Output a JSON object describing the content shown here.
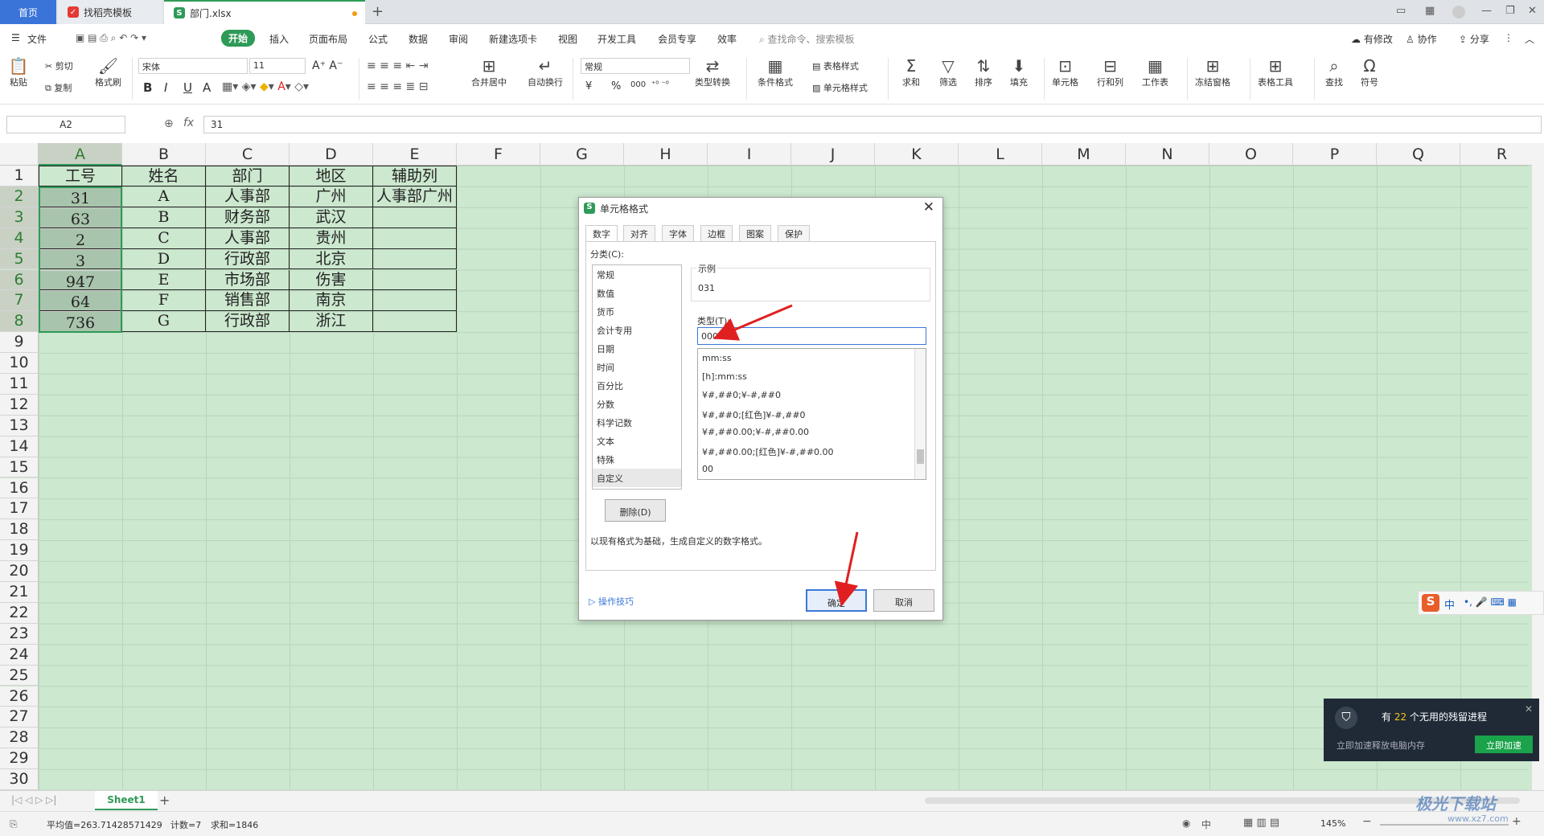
{
  "tabs": {
    "home": "首页",
    "template": "找稻壳模板",
    "file": "部门.xlsx",
    "new_tab": "+"
  },
  "menu": {
    "file": "文件",
    "items": [
      "开始",
      "插入",
      "页面布局",
      "公式",
      "数据",
      "审阅",
      "新建选项卡",
      "视图",
      "开发工具",
      "会员专享",
      "效率"
    ],
    "search_placeholder": "查找命令、搜索模板",
    "has_changes": "有修改",
    "collab": "协作",
    "share": "分享"
  },
  "ribbon": {
    "paste": "粘贴",
    "cut": "剪切",
    "copy": "复制",
    "format_painter": "格式刷",
    "font_name": "宋体",
    "font_size": "11",
    "bold": "B",
    "italic": "I",
    "underline": "U",
    "strike": "A",
    "merge_center": "合并居中",
    "auto_wrap": "自动换行",
    "number_format": "常规",
    "currency": "¥",
    "percent": "%",
    "thousands": "000",
    "type_convert": "类型转换",
    "cond_format": "条件格式",
    "table_style": "表格样式",
    "cell_style": "单元格样式",
    "sum": "求和",
    "filter": "筛选",
    "sort": "排序",
    "fill": "填充",
    "cell": "单元格",
    "row_col": "行和列",
    "worksheet": "工作表",
    "freeze": "冻结窗格",
    "table_tools": "表格工具",
    "find": "查找",
    "symbol": "符号"
  },
  "formula_bar": {
    "name_box": "A2",
    "fx": "fx",
    "value": "31"
  },
  "columns": [
    "A",
    "B",
    "C",
    "D",
    "E",
    "F",
    "G",
    "H",
    "I",
    "J",
    "K",
    "L",
    "M",
    "N",
    "O",
    "P",
    "Q",
    "R"
  ],
  "rows": [
    "1",
    "2",
    "3",
    "4",
    "5",
    "6",
    "7",
    "8",
    "9",
    "10",
    "11",
    "12",
    "13",
    "14",
    "15",
    "16",
    "17",
    "18",
    "19",
    "20",
    "21",
    "22",
    "23",
    "24",
    "25",
    "26",
    "27",
    "28",
    "29",
    "30"
  ],
  "table": {
    "headers": [
      "工号",
      "姓名",
      "部门",
      "地区",
      "辅助列"
    ],
    "rows": [
      [
        "31",
        "A",
        "人事部",
        "广州",
        "人事部广州"
      ],
      [
        "63",
        "B",
        "财务部",
        "武汉",
        ""
      ],
      [
        "2",
        "C",
        "人事部",
        "贵州",
        ""
      ],
      [
        "3",
        "D",
        "行政部",
        "北京",
        ""
      ],
      [
        "947",
        "E",
        "市场部",
        "伤害",
        ""
      ],
      [
        "64",
        "F",
        "销售部",
        "南京",
        ""
      ],
      [
        "736",
        "G",
        "行政部",
        "浙江",
        ""
      ]
    ]
  },
  "dialog": {
    "title": "单元格格式",
    "tabs": [
      "数字",
      "对齐",
      "字体",
      "边框",
      "图案",
      "保护"
    ],
    "category_label": "分类(C):",
    "categories": [
      "常规",
      "数值",
      "货币",
      "会计专用",
      "日期",
      "时间",
      "百分比",
      "分数",
      "科学记数",
      "文本",
      "特殊",
      "自定义"
    ],
    "sample_label": "示例",
    "sample_value": "031",
    "type_label": "类型(T):",
    "type_value": "000",
    "formats": [
      "mm:ss",
      "[h]:mm:ss",
      "¥#,##0;¥-#,##0",
      "¥#,##0;[红色]¥-#,##0",
      "¥#,##0.00;¥-#,##0.00",
      "¥#,##0.00;[红色]¥-#,##0.00",
      "00"
    ],
    "delete": "删除(D)",
    "description": "以现有格式为基础，生成自定义的数字格式。",
    "tips": "操作技巧",
    "ok": "确定",
    "cancel": "取消"
  },
  "sheet_tab": "Sheet1",
  "status": {
    "average": "平均值=263.71428571429",
    "count": "计数=7",
    "sum": "求和=1846",
    "zoom": "145%",
    "ime_lang": "中"
  },
  "toast": {
    "prefix": "有",
    "count": "22",
    "suffix": "个无用的残留进程",
    "sub": "立即加速释放电脑内存",
    "button": "立即加速"
  },
  "ime": {
    "lang": "中"
  },
  "watermark": "极光下载站",
  "watermark_url": "www.xz7.com",
  "colors": {
    "accent": "#2e9a58",
    "sheet_bg": "#cce8cf",
    "arrow": "#e02020"
  }
}
